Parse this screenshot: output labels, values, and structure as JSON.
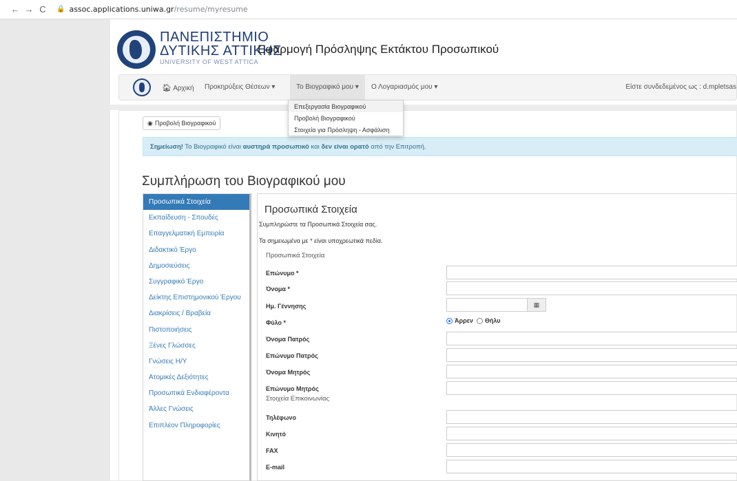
{
  "browser": {
    "url_host": "assoc.applications.uniwa.gr",
    "url_path": "/resume/myresume"
  },
  "header": {
    "uni_line1": "ΠΑΝΕΠΙΣΤΗΜΙΟ",
    "uni_line2": "ΔΥΤΙΚΗΣ ΑΤΤΙΚΗΣ",
    "uni_line3": "UNIVERSITY OF WEST ATTICA",
    "app_title": "Εφαρμογή Πρόσληψης Εκτάκτου Προσωπικού"
  },
  "navbar": {
    "home": "Αρχική",
    "positions": "Προκηρύξεις Θέσεων ▾",
    "resume": "Το Βιογραφικό μου ▾",
    "account": "Ο Λογαριασμός μου ▾",
    "user": "Είστε συνδεδεμένος ως : d.mpletsas"
  },
  "dropdown": [
    "Επεξεργασία Βιογραφικού",
    "Προβολή Βιογραφικού",
    "Στοιχεία για Πρόσληψη - Ασφάλιση"
  ],
  "view_button": "Προβολή Βιογραφικού",
  "alert": {
    "strong": "Σημείωση!",
    "text1": " Το Βιογραφικό είναι ",
    "bold1": "αυστηρά προσωπικό",
    "text2": " και ",
    "bold2": "δεν είναι ορατό",
    "text3": " από την Επιτροπή."
  },
  "page_title": "Συμπλήρωση του Βιογραφικού μου",
  "sidebar": [
    "Προσωπικά Στοιχεία",
    "Εκπαίδευση - Σπουδές",
    "Επαγγελματική Εμπειρία",
    "Διδακτικό Έργο",
    "Δημοσιεύσεις",
    "Συγγραφικό Έργο",
    "Δείκτης Επιστημονικού Έργου",
    "Διακρίσεις / Βραβεία",
    "Πιστοποιήσεις",
    "Ξένες Γλώσσες",
    "Γνώσεις Η/Υ",
    "Ατομικές Δεξιότητες",
    "Προσωπικά Ενδιαφέροντα",
    "Άλλες Γνώσεις",
    "Επιπλέον Πληροφορίες"
  ],
  "form": {
    "title": "Προσωπικά Στοιχεία",
    "subtitle": "Συμπληρώστε τα Προσωπικά Στοιχεία σας.",
    "required_note": "Τα σημειωμένα με * είναι υποχρεωτικά πεδία.",
    "section_personal": "Προσωπικά Στοιχεία",
    "section_contact": "Στοιχεία Επικοινωνίας",
    "labels": {
      "surname": "Επώνυμο *",
      "name": "Όνομα *",
      "dob": "Ημ. Γέννησης",
      "gender": "Φύλο *",
      "father_name": "Όνομα Πατρός",
      "father_surname": "Επώνυμο Πατρός",
      "mother_name": "Όνομα Μητρός",
      "mother_surname": "Επώνυμο Μητρός",
      "phone": "Τηλέφωνο",
      "mobile": "Κινητό",
      "fax": "FAX",
      "email": "E-mail"
    },
    "gender_options": [
      "Άρρεν",
      "Θήλυ"
    ],
    "gender_selected": "Άρρεν"
  }
}
